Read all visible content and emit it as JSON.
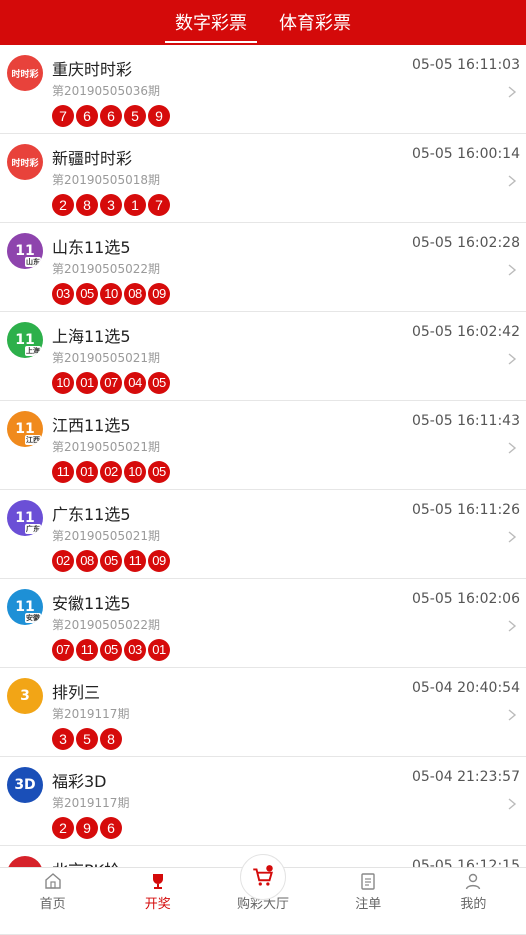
{
  "header": {
    "tabs": [
      {
        "label": "数字彩票"
      },
      {
        "label": "体育彩票"
      }
    ]
  },
  "lotteries": [
    {
      "name": "重庆时时彩",
      "issue": "第20190505036期",
      "time": "05-05 16:11:03",
      "balls": [
        "7",
        "6",
        "6",
        "5",
        "9"
      ],
      "logo_text": "时时彩",
      "logo_color": "#e8423b",
      "icon": "cqssc-logo-icon"
    },
    {
      "name": "新疆时时彩",
      "issue": "第20190505018期",
      "time": "05-05 16:00:14",
      "balls": [
        "2",
        "8",
        "3",
        "1",
        "7"
      ],
      "logo_text": "时时彩",
      "logo_color": "#e8423b",
      "icon": "xjssc-logo-icon"
    },
    {
      "name": "山东11选5",
      "issue": "第20190505022期",
      "time": "05-05 16:02:28",
      "balls": [
        "03",
        "05",
        "10",
        "08",
        "09"
      ],
      "logo_text": "11",
      "logo_color": "#8e44ad",
      "logo_sub": "山东",
      "icon": "sd11x5-logo-icon"
    },
    {
      "name": "上海11选5",
      "issue": "第20190505021期",
      "time": "05-05 16:02:42",
      "balls": [
        "10",
        "01",
        "07",
        "04",
        "05"
      ],
      "logo_text": "11",
      "logo_color": "#2db04b",
      "logo_sub": "上海",
      "icon": "sh11x5-logo-icon"
    },
    {
      "name": "江西11选5",
      "issue": "第20190505021期",
      "time": "05-05 16:11:43",
      "balls": [
        "11",
        "01",
        "02",
        "10",
        "05"
      ],
      "logo_text": "11",
      "logo_color": "#f08a1d",
      "logo_sub": "江西",
      "icon": "jx11x5-logo-icon"
    },
    {
      "name": "广东11选5",
      "issue": "第20190505021期",
      "time": "05-05 16:11:26",
      "balls": [
        "02",
        "08",
        "05",
        "11",
        "09"
      ],
      "logo_text": "11",
      "logo_color": "#6b4fd6",
      "logo_sub": "广东",
      "icon": "gd11x5-logo-icon"
    },
    {
      "name": "安徽11选5",
      "issue": "第20190505022期",
      "time": "05-05 16:02:06",
      "balls": [
        "07",
        "11",
        "05",
        "03",
        "01"
      ],
      "logo_text": "11",
      "logo_color": "#1e90d6",
      "logo_sub": "安徽",
      "icon": "ah11x5-logo-icon"
    },
    {
      "name": "排列三",
      "issue": "第2019117期",
      "time": "05-04 20:40:54",
      "balls": [
        "3",
        "5",
        "8"
      ],
      "logo_text": "3",
      "logo_color": "#f2a516",
      "icon": "pl3-logo-icon"
    },
    {
      "name": "福彩3D",
      "issue": "第2019117期",
      "time": "05-04 21:23:57",
      "balls": [
        "2",
        "9",
        "6"
      ],
      "logo_text": "3D",
      "logo_color": "#1a4fb8",
      "icon": "fc3d-logo-icon"
    },
    {
      "name": "北京PK拾",
      "issue": "",
      "time": "05-05 16:12:15",
      "balls": [],
      "logo_text": "PK",
      "logo_color": "#d6222a",
      "icon": "bjpk10-logo-icon"
    }
  ],
  "bottom_nav": [
    {
      "label": "首页",
      "icon": "home-icon"
    },
    {
      "label": "开奖",
      "icon": "trophy-icon"
    },
    {
      "label": "购彩大厅",
      "icon": "cart-icon"
    },
    {
      "label": "注单",
      "icon": "clipboard-icon"
    },
    {
      "label": "我的",
      "icon": "user-icon"
    }
  ],
  "colors": {
    "brand": "#d40a0a",
    "ball": "#d60b0b"
  }
}
